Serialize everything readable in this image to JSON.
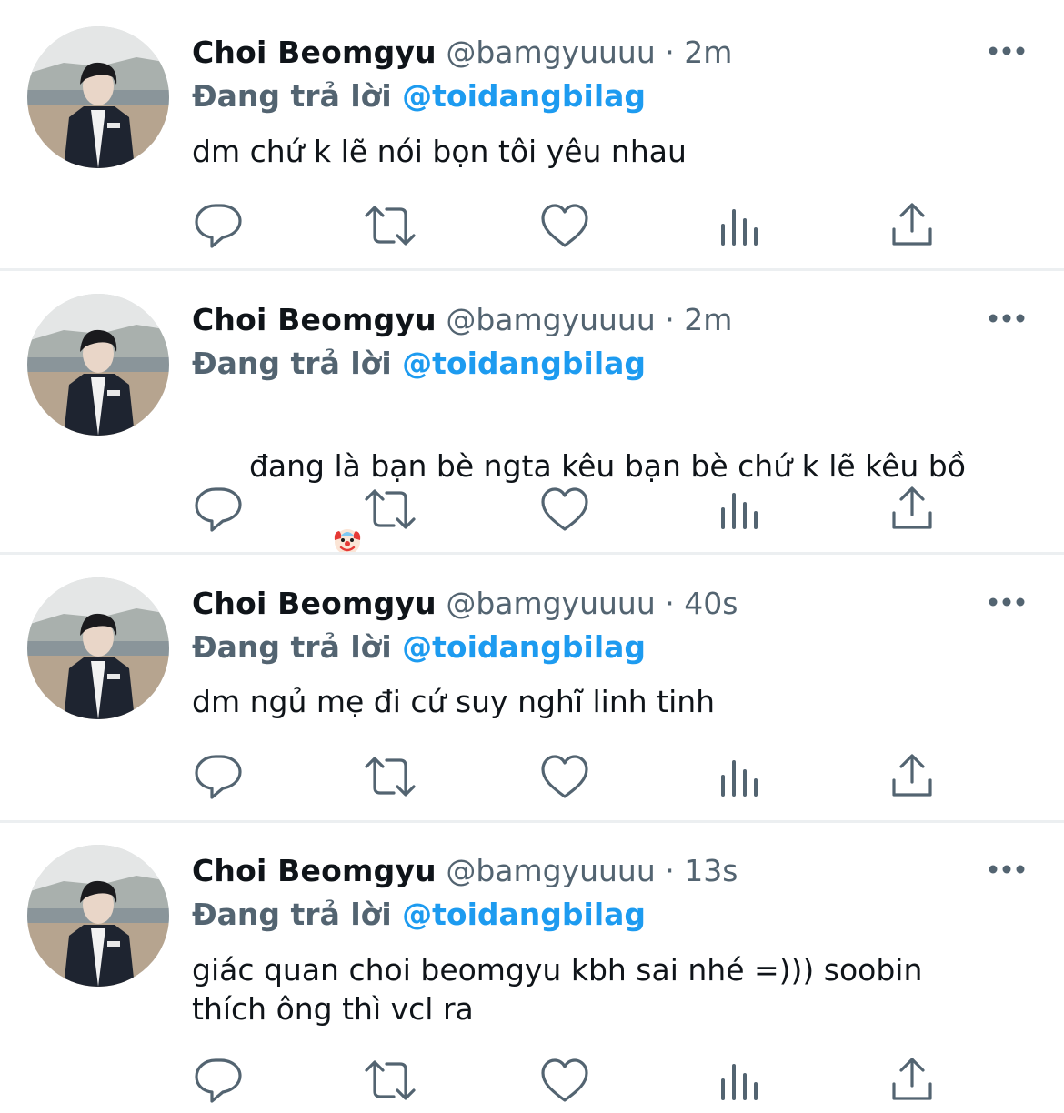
{
  "feed": {
    "tweets": [
      {
        "author_name": "Choi Beomgyu",
        "author_handle": "@bamgyuuuu",
        "separator": "·",
        "timestamp": "2m",
        "reply_prefix": "Đang trả lời",
        "reply_to": "@toidangbilag",
        "text": "dm chứ k lẽ nói bọn tôi yêu nhau"
      },
      {
        "author_name": "Choi Beomgyu",
        "author_handle": "@bamgyuuuu",
        "separator": "·",
        "timestamp": "2m",
        "reply_prefix": "Đang trả lời",
        "reply_to": "@toidangbilag",
        "text": "đang là bạn bè ngta kêu bạn bè chứ k lẽ kêu bồ",
        "emoji_icon": "clown-face-icon"
      },
      {
        "author_name": "Choi Beomgyu",
        "author_handle": "@bamgyuuuu",
        "separator": "·",
        "timestamp": "40s",
        "reply_prefix": "Đang trả lời",
        "reply_to": "@toidangbilag",
        "text": "dm ngủ mẹ đi cứ suy nghĩ linh tinh"
      },
      {
        "author_name": "Choi Beomgyu",
        "author_handle": "@bamgyuuuu",
        "separator": "·",
        "timestamp": "13s",
        "reply_prefix": "Đang trả lời",
        "reply_to": "@toidangbilag",
        "text": "giác quan choi beomgyu kbh sai nhé =))) soobin\nthích ông thì vcl ra"
      }
    ]
  },
  "icons": {
    "more": "more-options-icon",
    "reply": "reply-icon",
    "retweet": "retweet-icon",
    "like": "like-icon",
    "views": "views-icon",
    "share": "share-icon"
  },
  "colors": {
    "mention": "#1d9bf0",
    "secondary_text": "#536471",
    "primary_text": "#0f1419",
    "icon": "#536471",
    "divider": "#eceff1"
  }
}
